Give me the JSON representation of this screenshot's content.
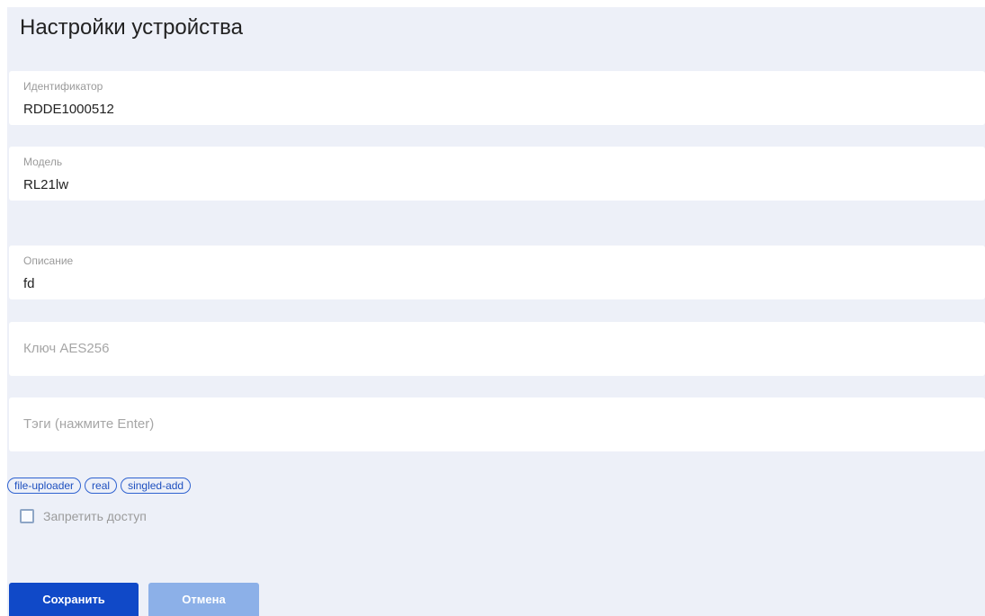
{
  "page": {
    "title": "Настройки устройства"
  },
  "fields": {
    "identifier": {
      "label": "Идентификатор",
      "value": "RDDE1000512"
    },
    "model": {
      "label": "Модель",
      "value": "RL21lw"
    },
    "description": {
      "label": "Описание",
      "value": "fd"
    },
    "aes_key": {
      "placeholder": "Ключ AES256",
      "value": ""
    },
    "tags_input": {
      "placeholder": "Тэги (нажмите Enter)",
      "value": ""
    }
  },
  "tags": [
    "file-uploader",
    "real",
    "singled-add"
  ],
  "deny_access": {
    "label": "Запретить доступ",
    "checked": false
  },
  "buttons": {
    "save": "Сохранить",
    "cancel": "Отмена"
  },
  "colors": {
    "primary": "#1049c8",
    "primary_disabled": "#8cb0e8",
    "background": "#edf0f8",
    "tag_border": "#2f62d0"
  }
}
